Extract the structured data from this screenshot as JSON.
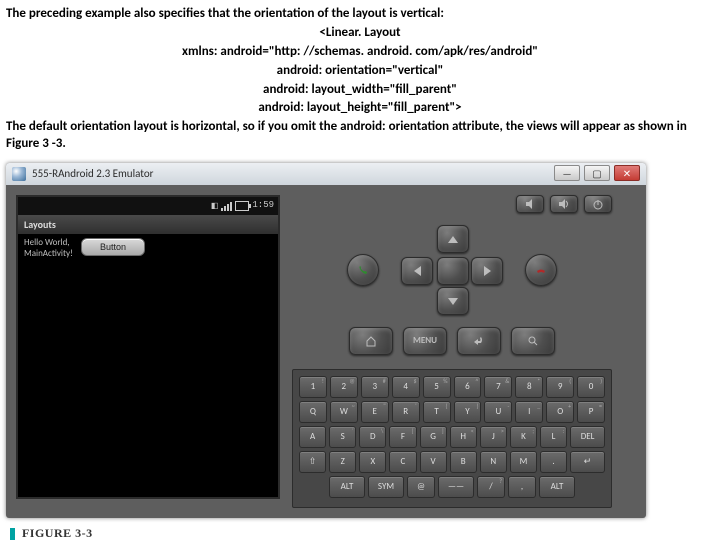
{
  "text": {
    "intro": "The preceding example also specifies that the orientation of the layout is vertical:",
    "code_lines": [
      "<Linear. Layout",
      "xmlns: android=\"http: //schemas. android. com/apk/res/android\"",
      "android: orientation=\"vertical\"",
      "android: layout_width=\"fill_parent\"",
      "android: layout_height=\"fill_parent\">"
    ],
    "outro": "The default orientation layout is horizontal, so if you omit the android: orientation attribute, the views will appear as shown in Figure 3 -3."
  },
  "emulator": {
    "window_title": "555-RAndroid 2.3 Emulator",
    "statusbar_time": "1:59",
    "app_title": "Layouts",
    "hello_text": "Hello World,\nMainActivity!",
    "button_label": "Button"
  },
  "hw_buttons": {
    "menu": "MENU"
  },
  "keyboard": {
    "r1": [
      [
        "1",
        "!"
      ],
      [
        "2",
        "@"
      ],
      [
        "3",
        "#"
      ],
      [
        "4",
        "$"
      ],
      [
        "5",
        "%"
      ],
      [
        "6",
        "^"
      ],
      [
        "7",
        "&"
      ],
      [
        "8",
        "*"
      ],
      [
        "9",
        "("
      ],
      [
        "0",
        ")"
      ]
    ],
    "r2": [
      [
        "Q",
        ""
      ],
      [
        "W",
        "~"
      ],
      [
        "E",
        "\""
      ],
      [
        "R",
        "'"
      ],
      [
        "T",
        "{"
      ],
      [
        "Y",
        "}"
      ],
      [
        "U",
        "-"
      ],
      [
        "I",
        "_"
      ],
      [
        "O",
        "+"
      ],
      [
        "P",
        "="
      ]
    ],
    "r3": [
      [
        "A",
        ""
      ],
      [
        "S",
        "`"
      ],
      [
        "D",
        "\\"
      ],
      [
        "F",
        "["
      ],
      [
        "G",
        "]"
      ],
      [
        "H",
        "<"
      ],
      [
        "J",
        ">"
      ],
      [
        "K",
        ";"
      ],
      [
        "L",
        ":"
      ],
      [
        "DEL",
        ""
      ]
    ],
    "r4": [
      [
        "⇧",
        ""
      ],
      [
        "Z",
        ""
      ],
      [
        "X",
        ""
      ],
      [
        "C",
        ""
      ],
      [
        "V",
        ""
      ],
      [
        "B",
        ""
      ],
      [
        "N",
        ""
      ],
      [
        "M",
        ""
      ],
      [
        ".",
        ""
      ],
      [
        "↵",
        ""
      ]
    ],
    "r5": [
      [
        "ALT",
        ""
      ],
      [
        "SYM",
        ""
      ],
      [
        "@",
        ""
      ],
      [
        "——",
        ""
      ],
      [
        "/",
        "?"
      ],
      [
        ",",
        ""
      ],
      [
        "ALT",
        ""
      ]
    ]
  },
  "caption": "FIGURE 3-3"
}
